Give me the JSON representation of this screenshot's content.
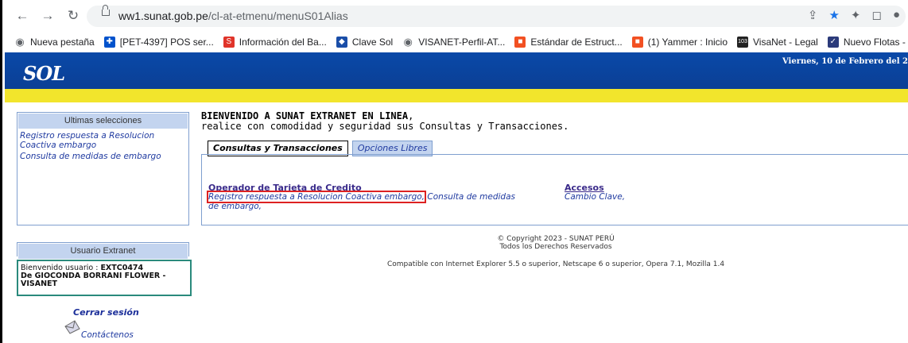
{
  "browser": {
    "url_host": "ww1.sunat.gob.pe",
    "url_path": "/cl-at-etmenu/menuS01Alias",
    "bookmarks": [
      {
        "label": "Nueva pestaña",
        "icon": "globe-icon",
        "color": "#5f6368"
      },
      {
        "label": "[PET-4397] POS ser...",
        "icon": "jira-icon",
        "color": "#0052cc"
      },
      {
        "label": "Información del Ba...",
        "icon": "s-logo-icon",
        "color": "#e0342a"
      },
      {
        "label": "Clave Sol",
        "icon": "diamond-icon",
        "color": "#1a4ea8"
      },
      {
        "label": "VISANET-Perfil-AT...",
        "icon": "globe-icon",
        "color": "#5f6368"
      },
      {
        "label": "Estándar de Estruct...",
        "icon": "windows-icon",
        "color": "#f25022"
      },
      {
        "label": "(1) Yammer : Inicio",
        "icon": "windows-icon",
        "color": "#f25022"
      },
      {
        "label": "VisaNet - Legal",
        "icon": "num-icon",
        "color": "#222"
      },
      {
        "label": "Nuevo Flotas - Sma...",
        "icon": "check-icon",
        "color": "#2b3a7a"
      }
    ],
    "bookmark_more": "»"
  },
  "header": {
    "logo": "SOL",
    "date": "Viernes, 10 de Febrero del 2"
  },
  "left": {
    "recent_title": "Ultimas selecciones",
    "recent_links": [
      "Registro respuesta a Resolucion Coactiva embargo",
      "Consulta de medidas de embargo"
    ],
    "user_title": "Usuario Extranet",
    "user_prefix": "Bienvenido usuario : ",
    "user_id": "EXTC0474",
    "user_name": "De GIOCONDA BORRANI FLOWER - VISANET",
    "logout": "Cerrar sesión",
    "contact": "Contáctenos"
  },
  "main": {
    "welcome_title": "BIENVENIDO A SUNAT EXTRANET EN LINEA",
    "welcome_sub": "realice con comodidad y seguridad sus Consultas y Transacciones.",
    "tabs": [
      "Consultas y Transacciones",
      "Opciones Libres"
    ],
    "section1_title": "Operador de Tarjeta de Credito",
    "section1_link1": "Registro respuesta a Resolucion Coactiva embargo,",
    "section1_link2": "Consulta de medidas de embargo,",
    "section2_title": "Accesos",
    "section2_link1": "Cambio Clave,"
  },
  "footer": {
    "copyright": "© Copyright 2023 - SUNAT PERÚ",
    "rights": "Todos los Derechos Reservados",
    "compat": "Compatible con Internet Explorer 5.5 o superior, Netscape 6 o superior, Opera 7.1, Mozilla 1.4"
  }
}
